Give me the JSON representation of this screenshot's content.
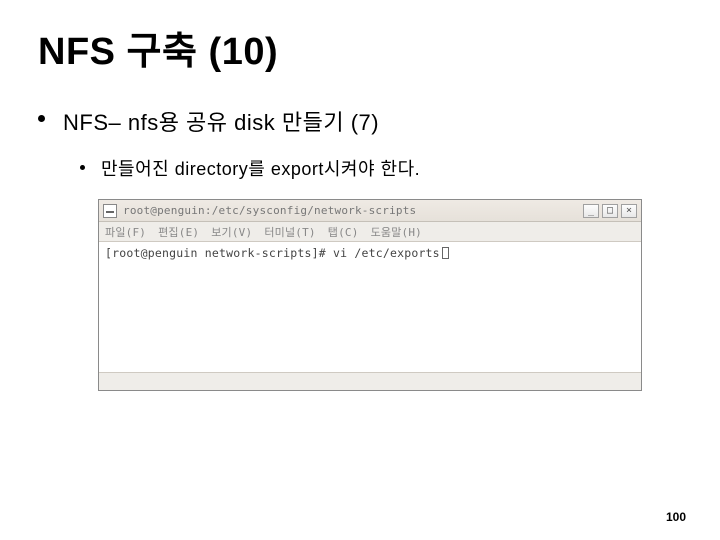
{
  "slide": {
    "title": "NFS 구축 (10)",
    "bullet1": "NFS– nfs용 공유 disk 만들기 (7)",
    "bullet2": "만들어진 directory를 export시켜야 한다.",
    "page_number": "100"
  },
  "terminal": {
    "title": "root@penguin:/etc/sysconfig/network-scripts",
    "menu": {
      "file": "파일(F)",
      "edit": "편집(E)",
      "view": "보기(V)",
      "terminal": "터미널(T)",
      "tabs": "탭(C)",
      "help": "도움말(H)"
    },
    "prompt_line": "[root@penguin network-scripts]# vi /etc/exports",
    "controls": {
      "min": "_",
      "max": "□",
      "close": "×"
    }
  }
}
